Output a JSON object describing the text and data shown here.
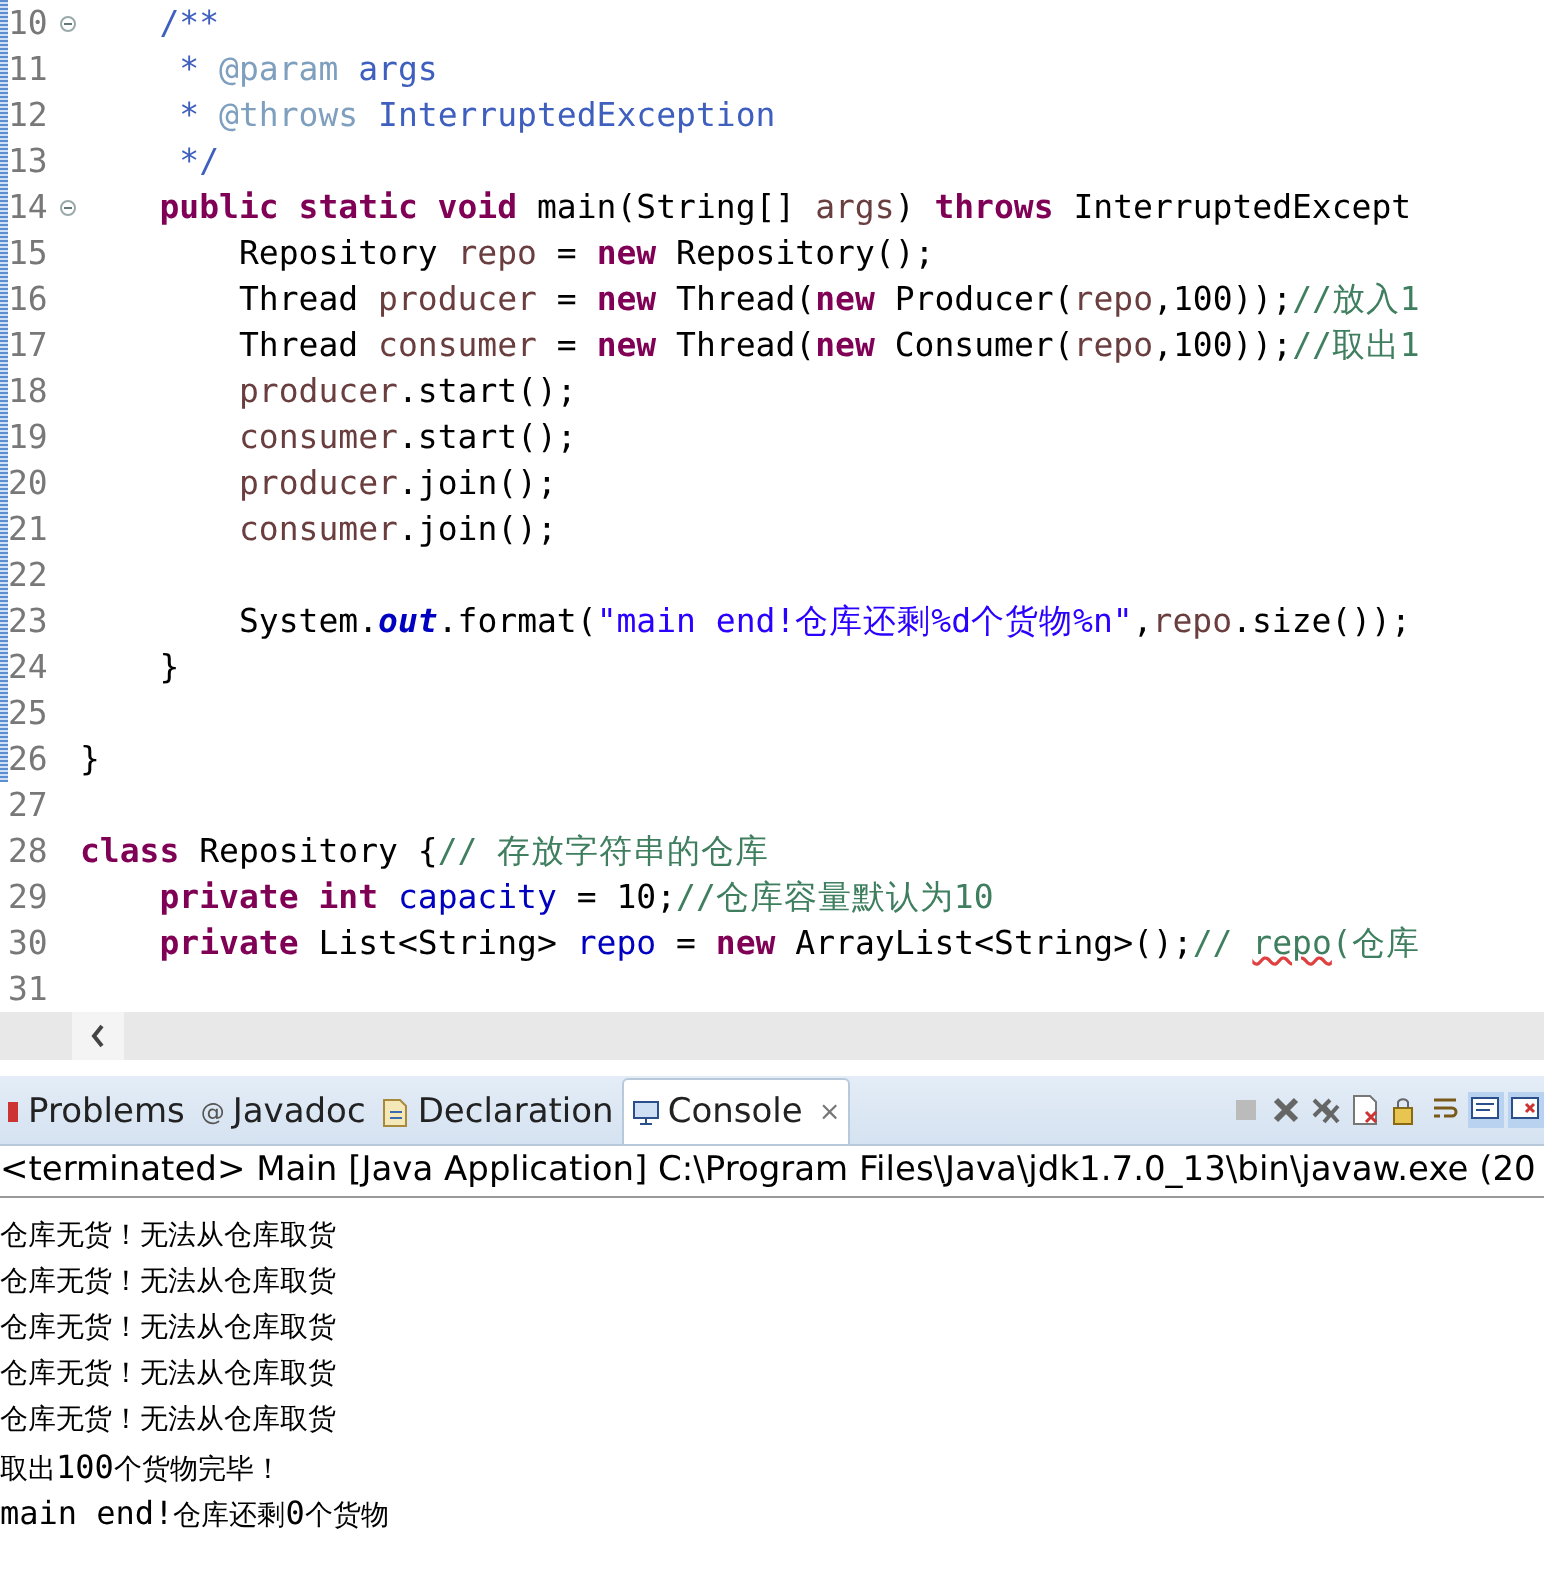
{
  "editor": {
    "lines": [
      {
        "children": [
          {
            "number": "10",
            "fold": true,
            "segments": [
              {
                "text": "/**",
                "kind": "doc"
              }
            ]
          },
          {
            "number": "11",
            "fold": false,
            "kind": "doc-continuation",
            "segments": [
              {
                "text": "* ",
                "kind": "doc"
              },
              {
                "text": "@param",
                "kind": "doctag"
              },
              {
                "text": " args",
                "kind": "doc"
              }
            ]
          },
          {
            "number": "12",
            "fold": false,
            "kind": "doc-continuation",
            "segments": [
              {
                "text": "* ",
                "kind": "doc"
              },
              {
                "text": "@throws",
                "kind": "doctag"
              },
              {
                "text": " InterruptedException",
                "kind": "doc"
              }
            ]
          },
          {
            "number": "13",
            "fold": false,
            "kind": "doc-continuation",
            "segments": [
              {
                "text": "*/",
                "kind": "doc"
              }
            ]
          },
          {
            "number": "14",
            "fold": true,
            "segments": [
              {
                "text": "public static void",
                "kind": "keyword"
              },
              {
                "text": " main(String[] ",
                "kind": "plain"
              },
              {
                "text": "args",
                "kind": "local"
              },
              {
                "text": ") ",
                "kind": "plain"
              },
              {
                "text": "throws",
                "kind": "keyword"
              },
              {
                "text": " InterruptedExcept",
                "kind": "plain"
              }
            ],
            "children": [
              {
                "number": "15",
                "fold": false,
                "segments": [
                  {
                    "text": "Repository ",
                    "kind": "plain"
                  },
                  {
                    "text": "repo",
                    "kind": "local"
                  },
                  {
                    "text": " = ",
                    "kind": "plain"
                  },
                  {
                    "text": "new",
                    "kind": "keyword"
                  },
                  {
                    "text": " Repository();",
                    "kind": "plain"
                  }
                ]
              },
              {
                "number": "16",
                "fold": false,
                "segments": [
                  {
                    "text": "Thread ",
                    "kind": "plain"
                  },
                  {
                    "text": "producer",
                    "kind": "local"
                  },
                  {
                    "text": " = ",
                    "kind": "plain"
                  },
                  {
                    "text": "new",
                    "kind": "keyword"
                  },
                  {
                    "text": " Thread(",
                    "kind": "plain"
                  },
                  {
                    "text": "new",
                    "kind": "keyword"
                  },
                  {
                    "text": " Producer(",
                    "kind": "plain"
                  },
                  {
                    "text": "repo",
                    "kind": "local"
                  },
                  {
                    "text": ",100));",
                    "kind": "plain"
                  },
                  {
                    "text": "//放入1",
                    "kind": "comment"
                  }
                ]
              },
              {
                "number": "17",
                "fold": false,
                "segments": [
                  {
                    "text": "Thread ",
                    "kind": "plain"
                  },
                  {
                    "text": "consumer",
                    "kind": "local"
                  },
                  {
                    "text": " = ",
                    "kind": "plain"
                  },
                  {
                    "text": "new",
                    "kind": "keyword"
                  },
                  {
                    "text": " Thread(",
                    "kind": "plain"
                  },
                  {
                    "text": "new",
                    "kind": "keyword"
                  },
                  {
                    "text": " Consumer(",
                    "kind": "plain"
                  },
                  {
                    "text": "repo",
                    "kind": "local"
                  },
                  {
                    "text": ",100));",
                    "kind": "plain"
                  },
                  {
                    "text": "//取出1",
                    "kind": "comment"
                  }
                ]
              },
              {
                "number": "18",
                "fold": false,
                "segments": [
                  {
                    "text": "producer",
                    "kind": "local"
                  },
                  {
                    "text": ".start();",
                    "kind": "plain"
                  }
                ]
              },
              {
                "number": "19",
                "fold": false,
                "segments": [
                  {
                    "text": "consumer",
                    "kind": "local"
                  },
                  {
                    "text": ".start();",
                    "kind": "plain"
                  }
                ]
              },
              {
                "number": "20",
                "fold": false,
                "segments": [
                  {
                    "text": "producer",
                    "kind": "local"
                  },
                  {
                    "text": ".join();",
                    "kind": "plain"
                  }
                ]
              },
              {
                "number": "21",
                "fold": false,
                "segments": [
                  {
                    "text": "consumer",
                    "kind": "local"
                  },
                  {
                    "text": ".join();",
                    "kind": "plain"
                  }
                ]
              },
              {
                "number": "22",
                "fold": false
              },
              {
                "number": "23",
                "fold": false,
                "segments": [
                  {
                    "text": "System.",
                    "kind": "plain"
                  },
                  {
                    "text": "out",
                    "kind": "static"
                  },
                  {
                    "text": ".format(",
                    "kind": "plain"
                  },
                  {
                    "text": "\"main end!仓库还剩%d个货物%n\"",
                    "kind": "string"
                  },
                  {
                    "text": ",",
                    "kind": "plain"
                  },
                  {
                    "text": "repo",
                    "kind": "local"
                  },
                  {
                    "text": ".size());",
                    "kind": "plain"
                  }
                ]
              }
            ]
          },
          {
            "number": "24",
            "fold": false,
            "segments": [
              {
                "text": "}",
                "kind": "plain"
              }
            ]
          },
          {
            "number": "25",
            "fold": false
          }
        ]
      },
      {
        "number": "26",
        "fold": false,
        "segments": [
          {
            "text": "}",
            "kind": "plain"
          }
        ]
      },
      {
        "number": "27",
        "fold": false
      },
      {
        "number": "28",
        "fold": false,
        "segments": [
          {
            "text": "class",
            "kind": "keyword"
          },
          {
            "text": " Repository {",
            "kind": "plain"
          },
          {
            "text": "// 存放字符串的仓库",
            "kind": "comment"
          }
        ],
        "children": [
          {
            "number": "29",
            "fold": false,
            "segments": [
              {
                "text": "private int",
                "kind": "keyword"
              },
              {
                "text": " capacity",
                "kind": "field"
              },
              {
                "text": " = 10;",
                "kind": "plain"
              },
              {
                "text": "//仓库容量默认为10",
                "kind": "comment"
              }
            ]
          },
          {
            "number": "30",
            "fold": false,
            "segments": [
              {
                "text": "private",
                "kind": "keyword"
              },
              {
                "text": " List<String> ",
                "kind": "plain"
              },
              {
                "text": "repo",
                "kind": "field"
              },
              {
                "text": " = ",
                "kind": "plain"
              },
              {
                "text": "new",
                "kind": "keyword"
              },
              {
                "text": " ArrayList<String>();",
                "kind": "plain"
              },
              {
                "text": "// ",
                "kind": "comment"
              },
              {
                "text": "repo",
                "kind": "misspelled"
              },
              {
                "text": "(仓库",
                "kind": "comment"
              }
            ]
          },
          {
            "number": "31",
            "fold": false
          }
        ]
      }
    ]
  },
  "views": {
    "tabs": [
      {
        "label": "Problems",
        "kind": "problems",
        "selected": false
      },
      {
        "label": "Javadoc",
        "kind": "javadoc",
        "icon": "@",
        "selected": false
      },
      {
        "label": "Declaration",
        "kind": "declaration",
        "selected": false
      },
      {
        "label": "Console",
        "kind": "console",
        "selected": true,
        "close": "×"
      }
    ]
  },
  "console": {
    "status": "<terminated> Main [Java Application] C:\\Program Files\\Java\\jdk1.7.0_13\\bin\\javaw.exe (20",
    "lines": [
      [
        {
          "text": "仓库无货！无法从仓库取货",
          "kind": "cjk"
        }
      ],
      [
        {
          "text": "仓库无货！无法从仓库取货",
          "kind": "cjk"
        }
      ],
      [
        {
          "text": "仓库无货！无法从仓库取货",
          "kind": "cjk"
        }
      ],
      [
        {
          "text": "仓库无货！无法从仓库取货",
          "kind": "cjk"
        }
      ],
      [
        {
          "text": "仓库无货！无法从仓库取货",
          "kind": "cjk"
        }
      ],
      [
        {
          "text": "取出",
          "kind": "cjk"
        },
        {
          "text": "100",
          "kind": "mono"
        },
        {
          "text": "个货物完毕！",
          "kind": "cjk"
        }
      ],
      [
        {
          "text": "main end!",
          "kind": "mono"
        },
        {
          "text": "仓库还剩",
          "kind": "cjk"
        },
        {
          "text": "0",
          "kind": "mono"
        },
        {
          "text": "个货物",
          "kind": "cjk"
        }
      ]
    ]
  }
}
